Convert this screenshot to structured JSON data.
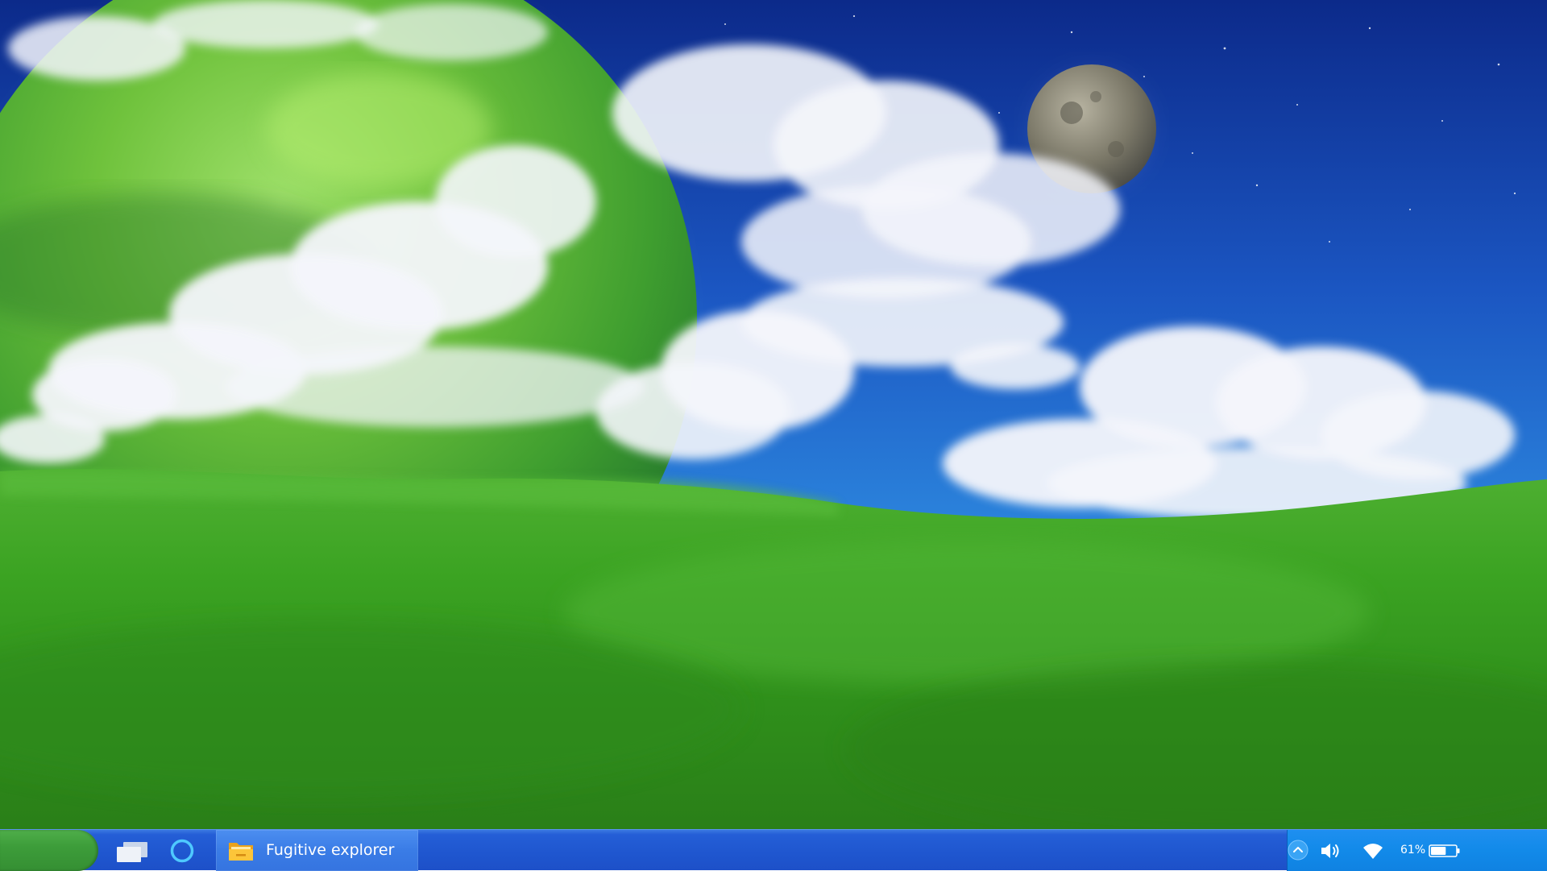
{
  "taskbar": {
    "start_label": "",
    "task_view_icon": "task-view-icon",
    "cortana_icon": "cortana-circle-icon",
    "open_app": {
      "icon": "folder-icon",
      "label": "Fugitive explorer"
    }
  },
  "tray": {
    "chevron_icon": "chevron-up-icon",
    "volume_icon": "speaker-icon",
    "wifi_icon": "wifi-icon",
    "battery_icon": "battery-icon",
    "battery_level": 0.61,
    "battery_text": "61%"
  },
  "colors": {
    "taskbar": "#1f56cf",
    "start": "#3d9d3a",
    "tray": "#128ae9",
    "active_app": "#3a7ce6"
  }
}
